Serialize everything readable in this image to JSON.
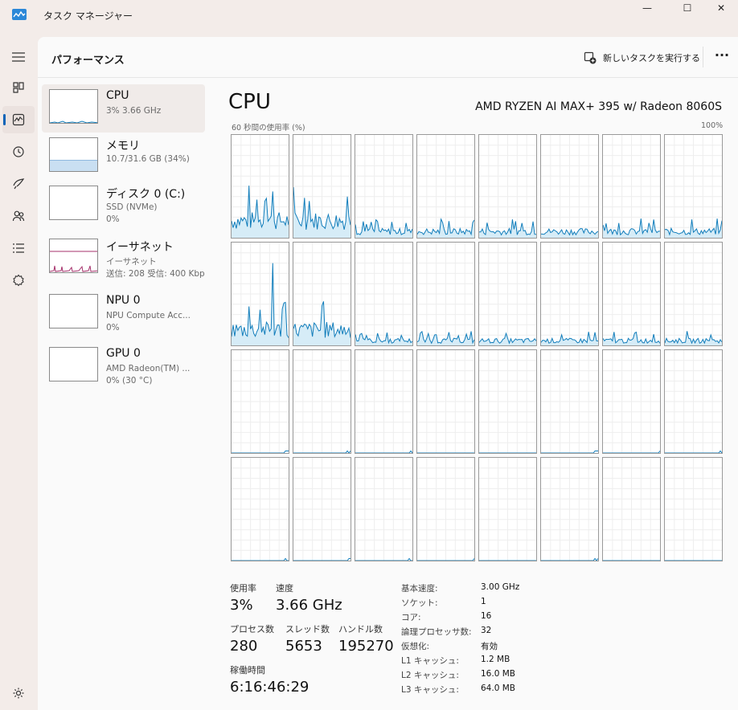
{
  "app": {
    "title": "タスク マネージャー"
  },
  "window": {
    "minimize": "—",
    "maximize": "☐",
    "close": "✕"
  },
  "command_bar": {
    "page_title": "パフォーマンス",
    "run_new_task": "新しいタスクを実行する",
    "more": "···"
  },
  "rail": [
    {
      "icon": "hamburger-menu-icon"
    },
    {
      "icon": "processes-icon"
    },
    {
      "icon": "performance-icon",
      "active": true
    },
    {
      "icon": "app-history-icon"
    },
    {
      "icon": "startup-apps-icon"
    },
    {
      "icon": "users-icon"
    },
    {
      "icon": "details-icon"
    },
    {
      "icon": "services-icon"
    },
    {
      "icon": "settings-icon"
    }
  ],
  "devices": [
    {
      "name": "CPU",
      "sub1": "3%  3.66 GHz",
      "selected": true,
      "level": 0.03
    },
    {
      "name": "メモリ",
      "sub1": "10.7/31.6 GB (34%)",
      "level": 0.34
    },
    {
      "name": "ディスク 0 (C:)",
      "sub1": "SSD (NVMe)",
      "sub2": "0%",
      "level": 0
    },
    {
      "name": "イーサネット",
      "sub1": "イーサネット",
      "sub2": "送信: 208 受信: 400 Kbp"
    },
    {
      "name": "NPU 0",
      "sub1": "NPU Compute Acc...",
      "sub2": "0%",
      "level": 0
    },
    {
      "name": "GPU 0",
      "sub1": "AMD Radeon(TM) ...",
      "sub2": "0% (30 °C)",
      "level": 0
    }
  ],
  "cpu": {
    "heading": "CPU",
    "model": "AMD RYZEN AI MAX+ 395 w/ Radeon 8060S",
    "graph_label_left": "60 秒間の使用率 (%)",
    "graph_label_right": "100%",
    "core_count": 32,
    "accent": "#117dbb",
    "fill": "#d6ecf7",
    "stats": {
      "utilization_label": "使用率",
      "utilization": "3%",
      "speed_label": "速度",
      "speed": "3.66 GHz",
      "processes_label": "プロセス数",
      "processes": "280",
      "threads_label": "スレッド数",
      "threads": "5653",
      "handles_label": "ハンドル数",
      "handles": "195270",
      "uptime_label": "稼働時間",
      "uptime": "6:16:46:29"
    },
    "specs": [
      {
        "key": "基本速度:",
        "value": "3.00 GHz"
      },
      {
        "key": "ソケット:",
        "value": "1"
      },
      {
        "key": "コア:",
        "value": "16"
      },
      {
        "key": "論理プロセッサ数:",
        "value": "32"
      },
      {
        "key": "仮想化:",
        "value": "有効"
      },
      {
        "key": "L1 キャッシュ:",
        "value": "1.2 MB"
      },
      {
        "key": "L2 キャッシュ:",
        "value": "16.0 MB"
      },
      {
        "key": "L3 キャッシュ:",
        "value": "64.0 MB"
      }
    ]
  }
}
